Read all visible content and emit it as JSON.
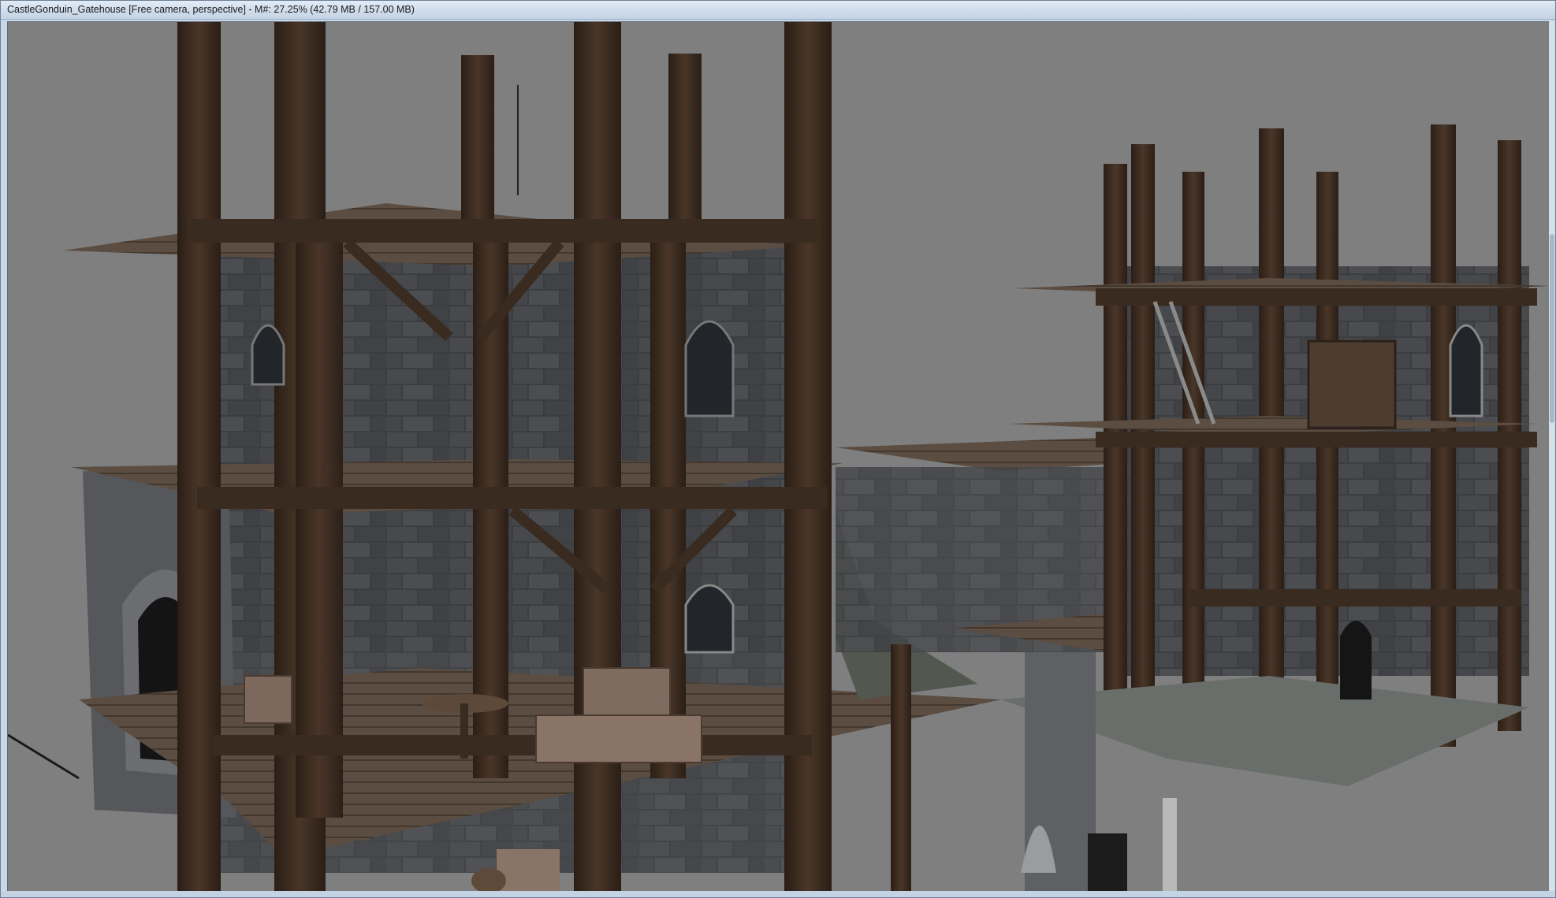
{
  "window": {
    "title": "CastleGonduin_Gatehouse [Free camera, perspective] - M#: 27.25% (42.79 MB / 157.00 MB)"
  },
  "viewport": {
    "scene_icon": "3d-render-icon",
    "background_color": "#7f7f7f",
    "wood_color": "#3a2b20",
    "stone_color": "#3d3e40",
    "plank_color": "#5a4c40"
  }
}
